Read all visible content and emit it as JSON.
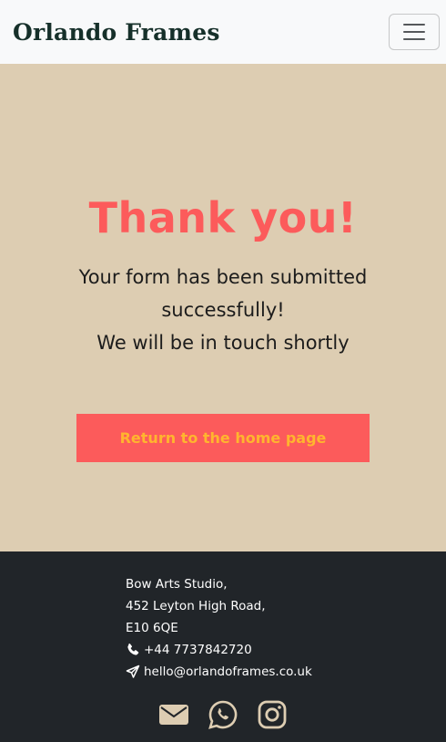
{
  "nav": {
    "brand": "Orlando Frames",
    "toggle_icon": "hamburger-menu-icon"
  },
  "main": {
    "heading": "Thank you!",
    "message_line1": "Your form has been submitted successfully!",
    "message_line2": "We will be in touch shortly",
    "button_label": "Return to the home page"
  },
  "footer": {
    "address_line1": "Bow Arts Studio,",
    "address_line2": "452 Leyton High Road,",
    "address_line3": "E10 6QE",
    "phone": "+44 7737842720",
    "email": "hello@orlandoframes.co.uk",
    "social_icons": [
      "envelope-icon",
      "whatsapp-icon",
      "instagram-icon"
    ]
  },
  "colors": {
    "nav_bg": "#f8f9fa",
    "hero_bg": "#ddcdb2",
    "accent_red": "#fc5b5b",
    "button_text": "#ffb52e",
    "footer_bg": "#212529",
    "footer_icons": "#ddcdb2"
  }
}
